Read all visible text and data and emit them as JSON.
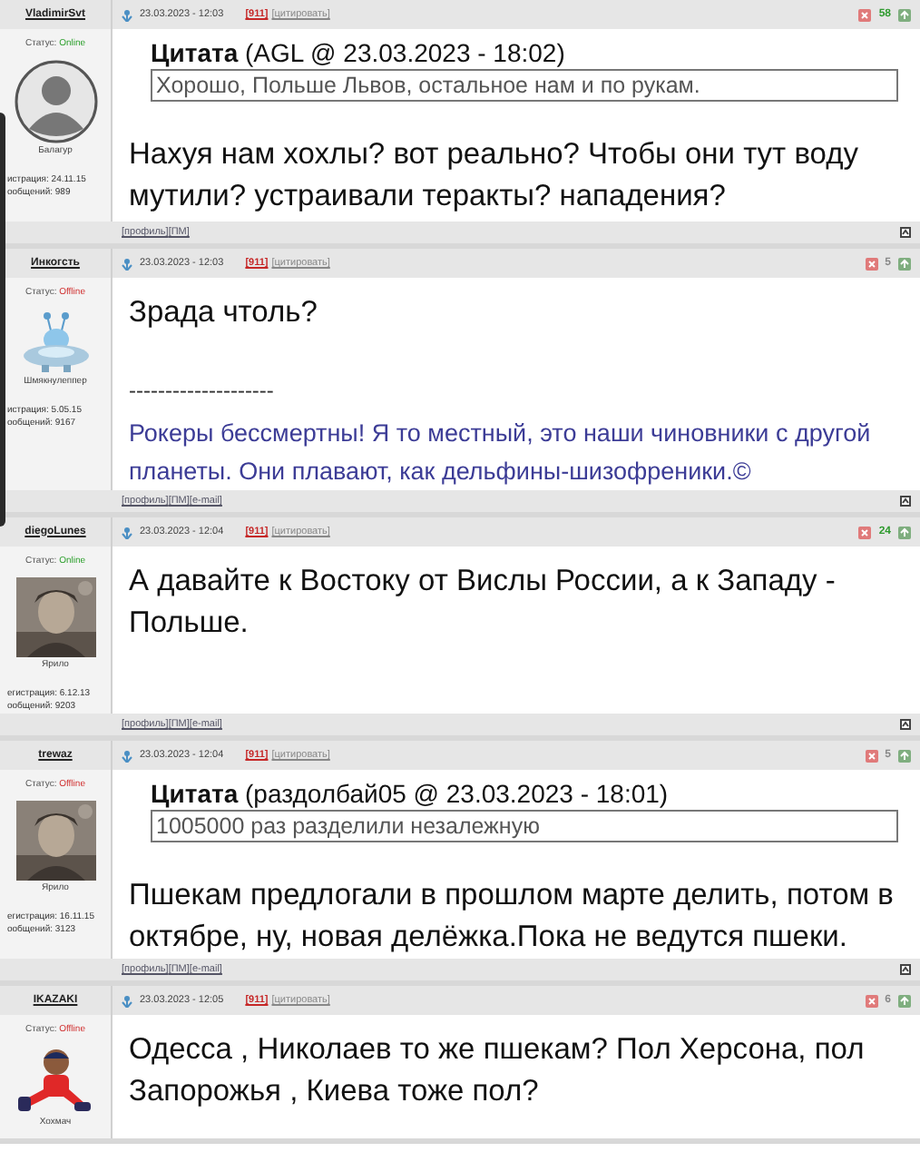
{
  "posts": [
    {
      "author": "VladimirSvt",
      "status": {
        "label": "Статус:",
        "value": "Online",
        "online": true
      },
      "avatar": {
        "kind": "silhouette"
      },
      "rank": "Балагур",
      "registered": "истрация: 24.11.15",
      "messages": "ообщений: 989",
      "date": "23.03.2023 - 12:03",
      "number": "[911]",
      "quote_link": "[цитировать]",
      "rating": {
        "text": "58",
        "color": "#2e9a2e"
      },
      "quote": {
        "title": "**Цитата** (AGL @ 23.03.2023 - 18:02)",
        "text": "Хорошо, Польше Львов, остальное нам и по рукам."
      },
      "text": "Нахуя нам хохлы? вот реально? Чтобы они тут воду мутили? устраивали теракты? нападения?",
      "links": [
        "[профиль]",
        "[ПМ]"
      ]
    },
    {
      "author": "Инкогсть",
      "status": {
        "label": "Статус:",
        "value": "Offline",
        "online": false
      },
      "avatar": {
        "kind": "ufo"
      },
      "rank": "Шмякнулеппер",
      "registered": "истрация: 5.05.15",
      "messages": "ообщений: 9167",
      "date": "23.03.2023 - 12:03",
      "number": "[911]",
      "quote_link": "[цитировать]",
      "rating": {
        "text": "5",
        "color": "#888888"
      },
      "text": "Зрада чтоль?",
      "signature": {
        "rule": "--------------------",
        "text": "Рокеры бессмертны! Я то местный, это наши чиновники с другой планеты. Они плавают, как дельфины-шизофреники.©"
      },
      "links": [
        "[профиль]",
        "[ПМ]",
        "[e-mail]"
      ]
    },
    {
      "author": "diegoLunes",
      "status": {
        "label": "Статус:",
        "value": "Online",
        "online": true
      },
      "rank": "Ярило",
      "registered": "егистрация: 6.12.13",
      "messages": "ообщений: 9203",
      "date": "23.03.2023 - 12:04",
      "number": "[911]",
      "quote_link": "[цитировать]",
      "rating": {
        "text": "24",
        "color": "#2e9a2e"
      },
      "text": "А давайте к Востоку от Вислы России, а к Западу - Польше.",
      "links": [
        "[профиль]",
        "[ПМ]",
        "[e-mail]"
      ]
    },
    {
      "author": "trewaz",
      "status": {
        "label": "Статус:",
        "value": "Offline",
        "online": false
      },
      "rank": "Ярило",
      "registered": "егистрация: 16.11.15",
      "messages": "ообщений: 3123",
      "date": "23.03.2023 - 12:04",
      "number": "[911]",
      "quote_link": "[цитировать]",
      "rating": {
        "text": "5",
        "color": "#888888"
      },
      "quote": {
        "title": "**Цитата** (раздолбай05 @ 23.03.2023 - 18:01)",
        "text": "1005000 раз разделили незалежную"
      },
      "text": "Пшекам предлогали в прошлом марте делить, потом в октябре, ну, новая делёжка.Пока не ведутся пшеки.",
      "links": [
        "[профиль]",
        "[ПМ]",
        "[e-mail]"
      ]
    },
    {
      "author": "IKAZAKI",
      "status": {
        "label": "Статус:",
        "value": "Offline",
        "online": false
      },
      "avatar": {
        "kind": "cartoon"
      },
      "rank": "Хохмач",
      "date": "23.03.2023 - 12:05",
      "number": "[911]",
      "quote_link": "[цитировать]",
      "rating": {
        "text": "6",
        "color": "#888888"
      },
      "text": "Одесса , Николаев то же пшекам? Пол Херсона, пол Запорожья , Киева тоже пол?"
    }
  ]
}
